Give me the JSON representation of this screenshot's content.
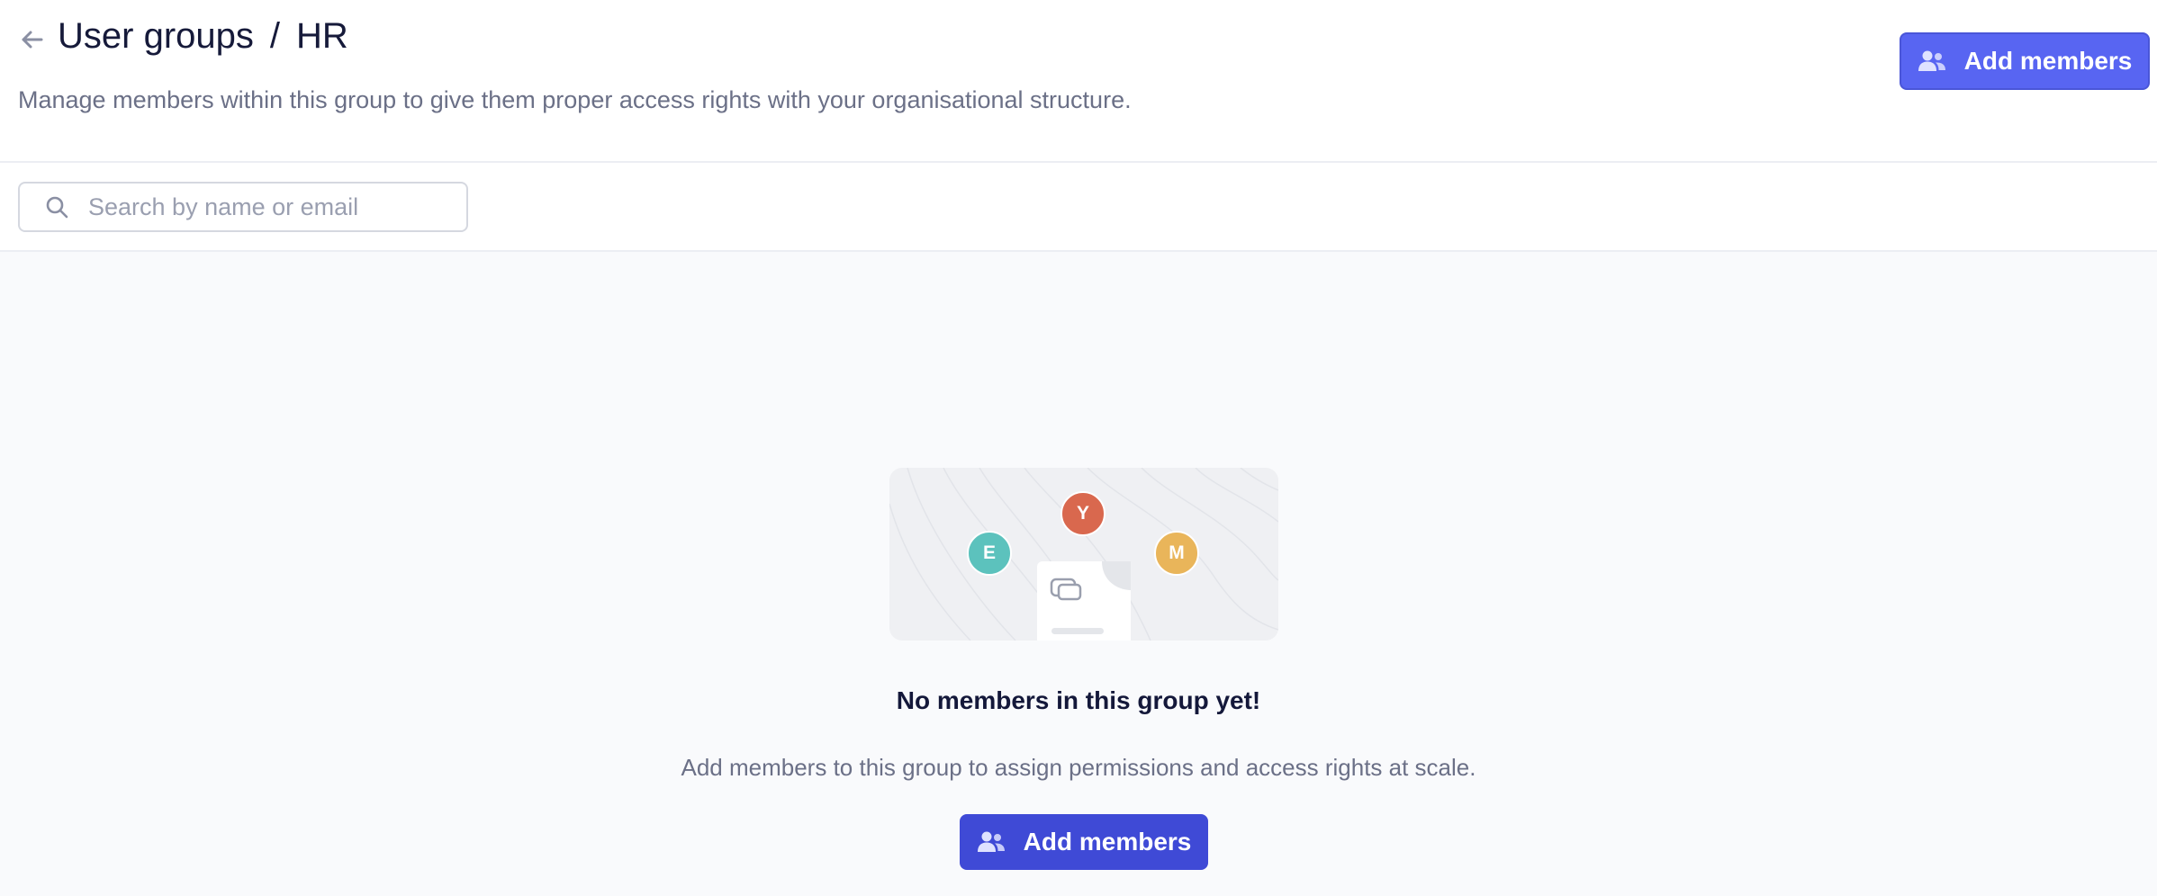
{
  "header": {
    "breadcrumb_parent": "User groups",
    "breadcrumb_separator": "/",
    "breadcrumb_current": "HR",
    "description": "Manage members within this group to give them proper access rights with your organisational structure.",
    "add_members_label": "Add members"
  },
  "search": {
    "placeholder": "Search by name or email",
    "value": ""
  },
  "empty_state": {
    "avatars": [
      {
        "letter": "E",
        "color": "#5cc2bd"
      },
      {
        "letter": "Y",
        "color": "#d9684e"
      },
      {
        "letter": "M",
        "color": "#e9b55a"
      }
    ],
    "title": "No members in this group yet!",
    "description": "Add members to this group to assign permissions and access rights at scale.",
    "button_label": "Add members"
  },
  "colors": {
    "primary": "#5865f2",
    "primary_dark": "#3f4ad6",
    "text_muted": "#6b7087"
  },
  "icons": {
    "back": "arrow-left-icon",
    "users": "users-icon",
    "search": "search-icon",
    "document": "document-icon"
  }
}
